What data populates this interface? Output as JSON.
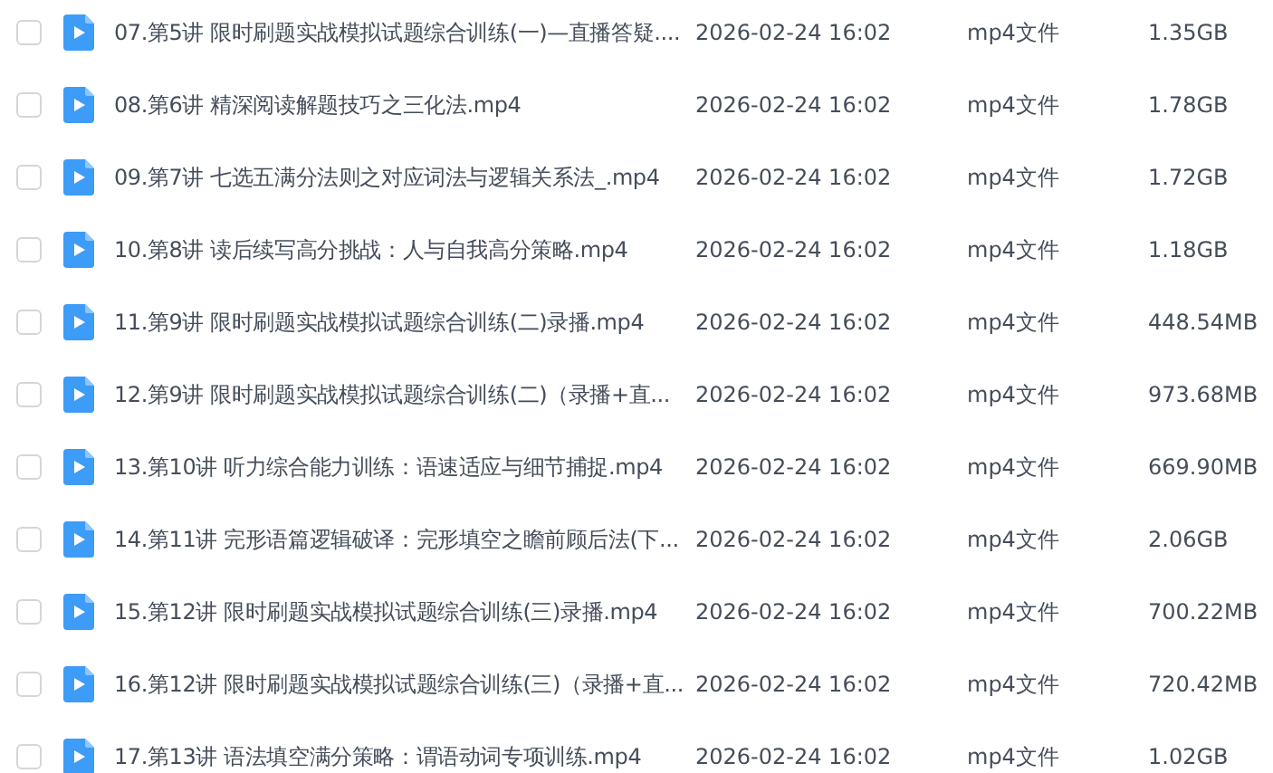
{
  "files": [
    {
      "checked": false,
      "name": "07.第5讲 限时刷题实战模拟试题综合训练(一)—直播答疑....",
      "modified": "2026-02-24 16:02",
      "type": "mp4文件",
      "size": "1.35GB"
    },
    {
      "checked": false,
      "name": "08.第6讲 精深阅读解题技巧之三化法.mp4",
      "modified": "2026-02-24 16:02",
      "type": "mp4文件",
      "size": "1.78GB"
    },
    {
      "checked": false,
      "name": "09.第7讲 七选五满分法则之对应词法与逻辑关系法_.mp4",
      "modified": "2026-02-24 16:02",
      "type": "mp4文件",
      "size": "1.72GB"
    },
    {
      "checked": false,
      "name": "10.第8讲 读后续写高分挑战：人与自我高分策略.mp4",
      "modified": "2026-02-24 16:02",
      "type": "mp4文件",
      "size": "1.18GB"
    },
    {
      "checked": false,
      "name": "11.第9讲 限时刷题实战模拟试题综合训练(二)录播.mp4",
      "modified": "2026-02-24 16:02",
      "type": "mp4文件",
      "size": "448.54MB"
    },
    {
      "checked": false,
      "name": "12.第9讲 限时刷题实战模拟试题综合训练(二)（录播+直...",
      "modified": "2026-02-24 16:02",
      "type": "mp4文件",
      "size": "973.68MB"
    },
    {
      "checked": false,
      "name": "13.第10讲 听力综合能力训练：语速适应与细节捕捉.mp4",
      "modified": "2026-02-24 16:02",
      "type": "mp4文件",
      "size": "669.90MB"
    },
    {
      "checked": false,
      "name": "14.第11讲 完形语篇逻辑破译：完形填空之瞻前顾后法(下...",
      "modified": "2026-02-24 16:02",
      "type": "mp4文件",
      "size": "2.06GB"
    },
    {
      "checked": false,
      "name": "15.第12讲 限时刷题实战模拟试题综合训练(三)录播.mp4",
      "modified": "2026-02-24 16:02",
      "type": "mp4文件",
      "size": "700.22MB"
    },
    {
      "checked": false,
      "name": "16.第12讲 限时刷题实战模拟试题综合训练(三)（录播+直...",
      "modified": "2026-02-24 16:02",
      "type": "mp4文件",
      "size": "720.42MB"
    },
    {
      "checked": false,
      "name": "17.第13讲 语法填空满分策略：谓语动词专项训练.mp4",
      "modified": "2026-02-24 16:02",
      "type": "mp4文件",
      "size": "1.02GB"
    }
  ]
}
